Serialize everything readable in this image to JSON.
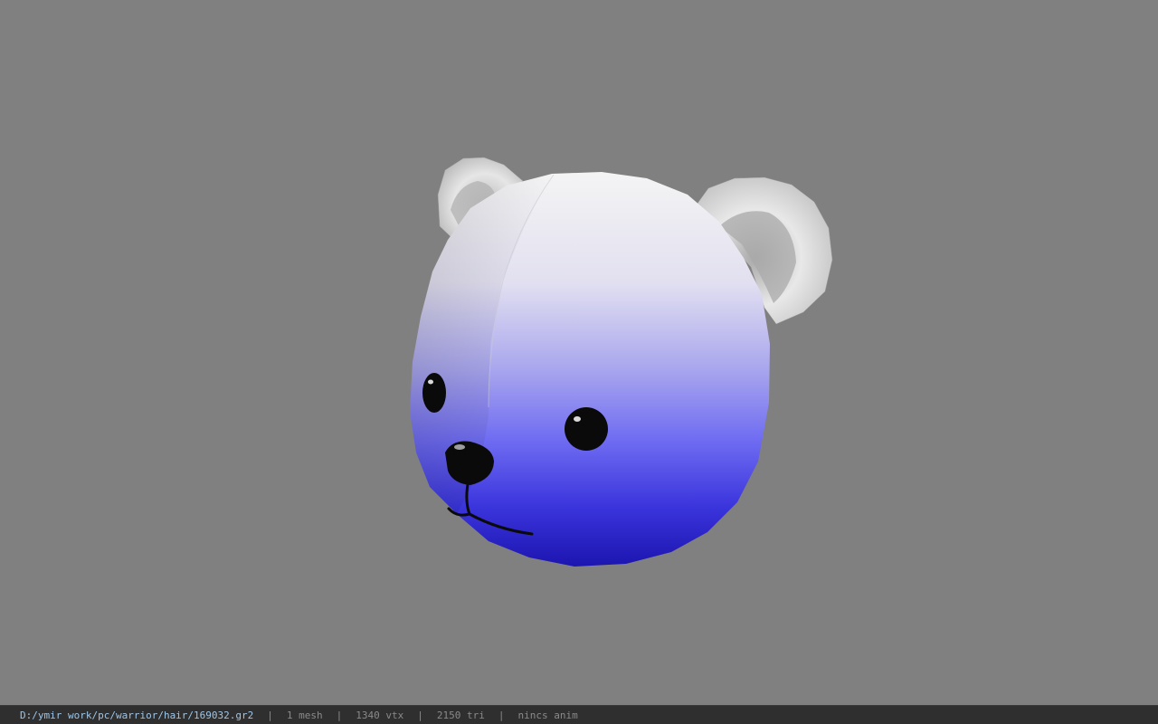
{
  "viewport": {
    "background": "#808080",
    "model": {
      "subject": "bear-head",
      "colors": {
        "top": "#f2f2f2",
        "mid": "#8080ff",
        "bottom": "#1a14c8",
        "ears": "#d8d8d8",
        "features": "#0a0a0a"
      }
    }
  },
  "statusbar": {
    "file_path": "D:/ymir work/pc/warrior/hair/169032.gr2",
    "separator": "|",
    "mesh_count": "1 mesh",
    "vertex_count": "1340 vtx",
    "triangle_count": "2150 tri",
    "anim_status": "nincs anim"
  }
}
